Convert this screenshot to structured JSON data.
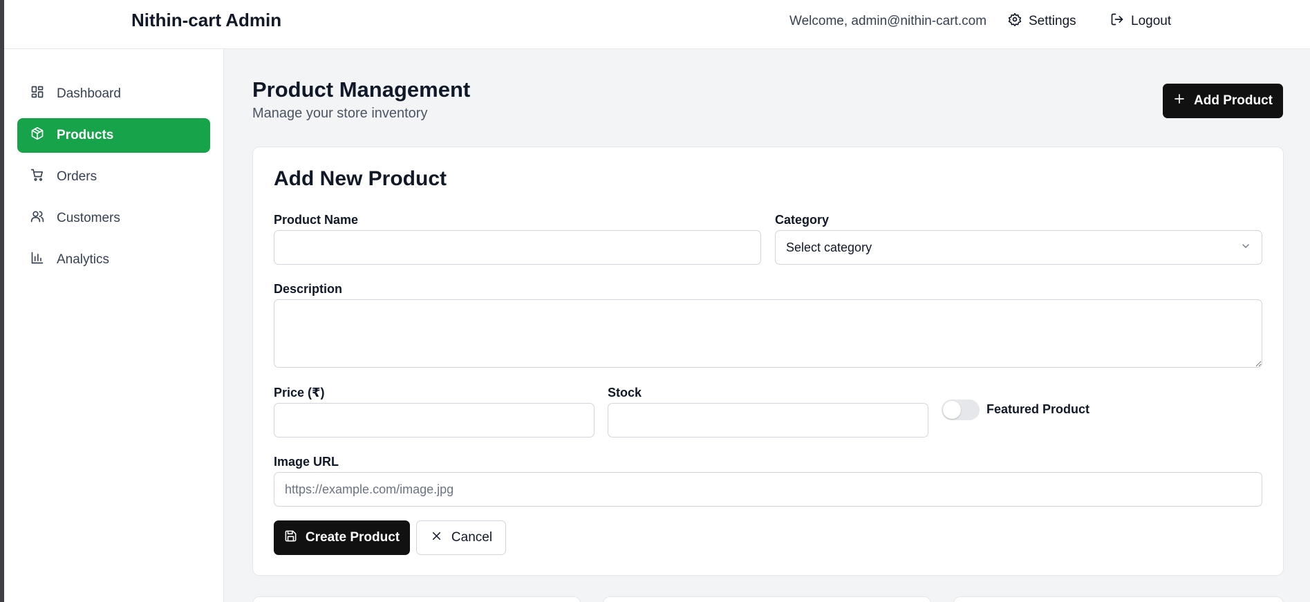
{
  "header": {
    "brand": "Nithin-cart Admin",
    "welcome": "Welcome, admin@nithin-cart.com",
    "settings_label": "Settings",
    "logout_label": "Logout"
  },
  "sidebar": {
    "items": [
      {
        "label": "Dashboard",
        "icon": "dashboard-icon",
        "active": false
      },
      {
        "label": "Products",
        "icon": "package-icon",
        "active": true
      },
      {
        "label": "Orders",
        "icon": "cart-icon",
        "active": false
      },
      {
        "label": "Customers",
        "icon": "users-icon",
        "active": false
      },
      {
        "label": "Analytics",
        "icon": "bar-chart-icon",
        "active": false
      }
    ]
  },
  "main": {
    "title": "Product Management",
    "subtitle": "Manage your store inventory",
    "add_button": "Add Product"
  },
  "form": {
    "title": "Add New Product",
    "product_name": {
      "label": "Product Name",
      "value": "",
      "placeholder": ""
    },
    "category": {
      "label": "Category",
      "value": "Select category"
    },
    "description": {
      "label": "Description",
      "value": ""
    },
    "price": {
      "label": "Price (₹)",
      "value": ""
    },
    "stock": {
      "label": "Stock",
      "value": ""
    },
    "featured": {
      "label": "Featured Product",
      "on": false
    },
    "image_url": {
      "label": "Image URL",
      "placeholder": "https://example.com/image.jpg"
    },
    "create_button": "Create Product",
    "cancel_button": "Cancel"
  },
  "colors": {
    "accent": "#16a34a",
    "primary_button": "#111111",
    "background": "#f3f4f6"
  }
}
